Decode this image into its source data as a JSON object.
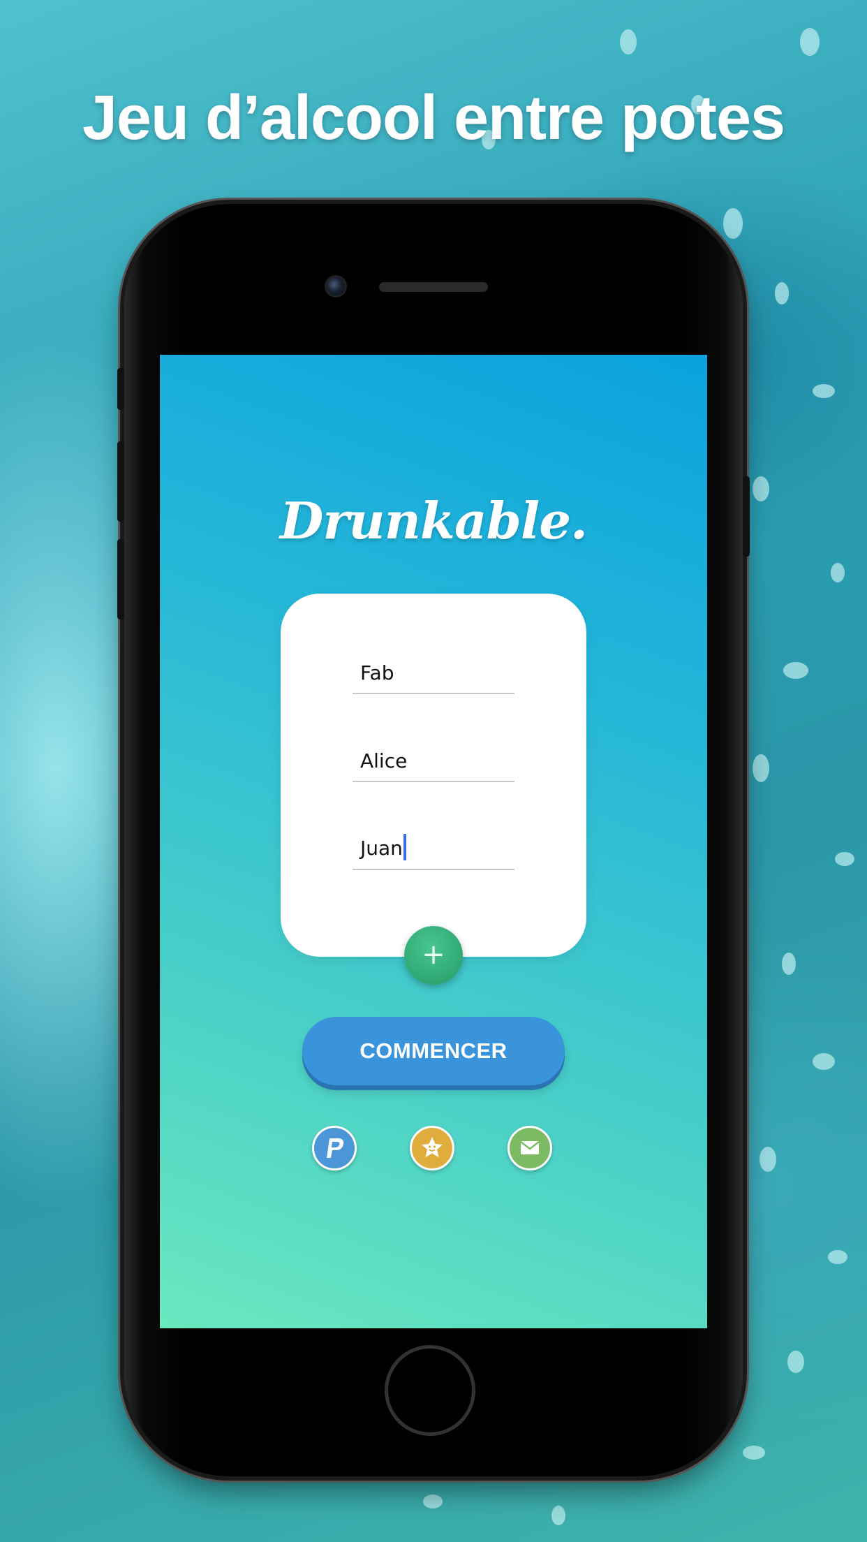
{
  "headline": "Jeu d’alcool entre potes",
  "app": {
    "logo": "Drunkable."
  },
  "players": [
    {
      "name": "Fab"
    },
    {
      "name": "Alice"
    },
    {
      "name": "Juan"
    }
  ],
  "buttons": {
    "add_symbol": "+",
    "start_label": "COMMENCER"
  },
  "social_icons": [
    "paypal-icon",
    "star-icon",
    "mail-icon"
  ],
  "colors": {
    "start_button": "#3a94dc",
    "add_button": "#2fa874",
    "paypal": "#4b96d6",
    "rate": "#e0ad3d",
    "mail": "#7cbb63"
  }
}
